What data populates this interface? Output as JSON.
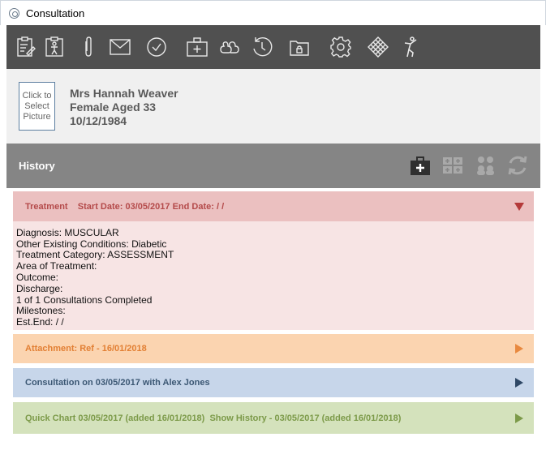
{
  "window": {
    "title": "Consultation"
  },
  "toolbar": {
    "icons": [
      "clipboard-edit-icon",
      "clipboard-person-icon",
      "paperclip-icon",
      "envelope-icon",
      "checkmark-circle-icon",
      "medical-kit-icon",
      "cloud-shapes-icon",
      "history-clock-icon",
      "folder-lock-icon",
      "settings-gear-icon",
      "diamond-grid-icon",
      "person-pose-icon"
    ]
  },
  "patient": {
    "photo_label": "Click to Select Picture",
    "name": "Mrs Hannah Weaver",
    "info": "Female Aged 33",
    "dob": "10/12/1984"
  },
  "history": {
    "title": "History",
    "actions": [
      "add-treatment-icon",
      "medical-group-icon",
      "people-group-icon",
      "refresh-icon"
    ]
  },
  "treatment": {
    "header": "Treatment    Start Date: 03/05/2017 End Date: / /",
    "lines": [
      "Diagnosis: MUSCULAR",
      "Other Existing Conditions: Diabetic",
      "Treatment Category: ASSESSMENT",
      "Area of Treatment:",
      "Outcome:",
      "Discharge:",
      "1 of 1 Consultations Completed",
      "Milestones:",
      "Est.End: / /"
    ]
  },
  "attachment": {
    "header": "Attachment: Ref - 16/01/2018"
  },
  "consultation": {
    "header": "Consultation on 03/05/2017 with Alex Jones"
  },
  "quick_chart": {
    "header": "Quick Chart 03/05/2017 (added 16/01/2018)  Show History - 03/05/2017 (added 16/01/2018)"
  },
  "colors": {
    "toolbar_bg": "#505050",
    "history_bg": "#858585",
    "treatment_head": "#ebc0c0",
    "treatment_body": "#f7e4e4",
    "attachment_head": "#fbd4b0",
    "consultation_head": "#c7d6ea",
    "quick_head": "#d4e2bc"
  }
}
